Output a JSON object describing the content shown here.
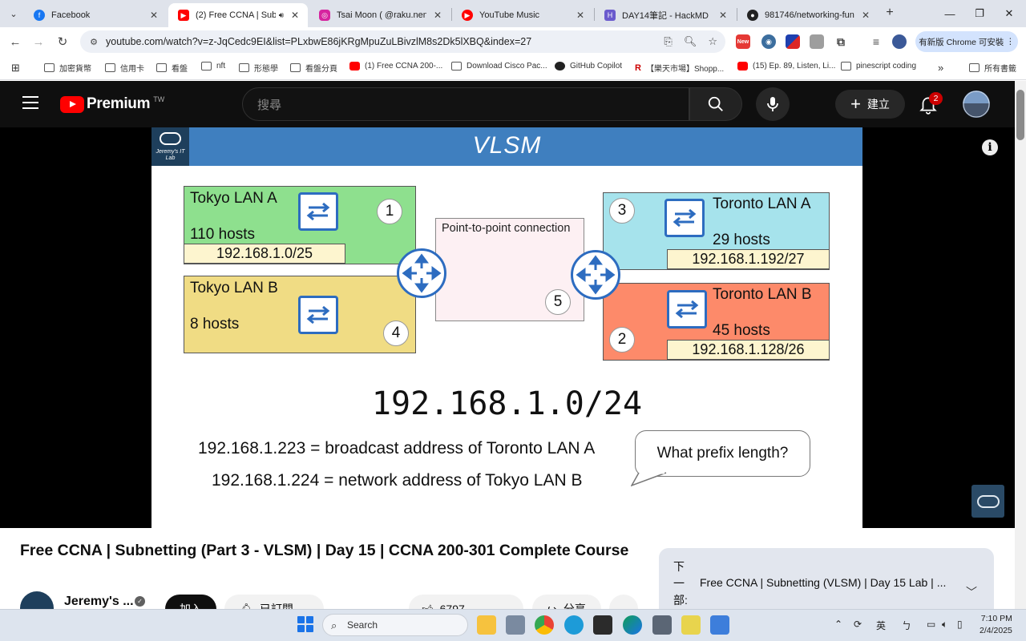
{
  "browser": {
    "tabs": [
      {
        "title": "Facebook",
        "favicon_color": "#1877f2"
      },
      {
        "title": "(2) Free CCNA | Subnet",
        "favicon_color": "#ff0000",
        "active": true
      },
      {
        "title": "Tsai Moon ( @raku.nene )",
        "favicon_color": "#d6249f"
      },
      {
        "title": "YouTube Music",
        "favicon_color": "#ff0000"
      },
      {
        "title": "DAY14筆記 - HackMD",
        "favicon_color": "#6a5acd"
      },
      {
        "title": "981746/networking-funda",
        "favicon_color": "#222222"
      }
    ],
    "url": "youtube.com/watch?v=z-JqCedc9EI&list=PLxbwE86jKRgMpuZuLBivzlM8s2Dk5lXBQ&index=27",
    "update_button": "有新版 Chrome 可安裝",
    "ext_new_badge": "New",
    "bookmarks": [
      {
        "label": "加密貨幣",
        "type": "folder"
      },
      {
        "label": "信用卡",
        "type": "folder"
      },
      {
        "label": "看盤",
        "type": "folder"
      },
      {
        "label": "nft",
        "type": "folder"
      },
      {
        "label": "形態學",
        "type": "folder"
      },
      {
        "label": "看盤分頁",
        "type": "folder"
      },
      {
        "label": "(1) Free CCNA 200-...",
        "type": "yt"
      },
      {
        "label": "Download Cisco Pac...",
        "type": "folder"
      },
      {
        "label": "GitHub Copilot",
        "type": "gh"
      },
      {
        "label": "【樂天市場】Shopp...",
        "type": "r"
      },
      {
        "label": "(15) Ep. 89, Listen, Li...",
        "type": "yt"
      },
      {
        "label": "pinescript coding",
        "type": "folder"
      }
    ],
    "bookmarks_overflow": "»",
    "all_bookmarks": "所有書籤"
  },
  "youtube": {
    "brand": "Premium",
    "region": "TW",
    "search_placeholder": "搜尋",
    "create_label": "建立",
    "notification_count": "2"
  },
  "slide": {
    "title": "VLSM",
    "logo_text": "Jeremy's IT Lab",
    "tokyo_a": {
      "name": "Tokyo LAN A",
      "hosts": "110 hosts",
      "address": "192.168.1.0/25",
      "number": "1"
    },
    "tokyo_b": {
      "name": "Tokyo LAN B",
      "hosts": "8 hosts",
      "number": "4"
    },
    "toronto_a": {
      "name": "Toronto LAN A",
      "hosts": "29 hosts",
      "address": "192.168.1.192/27",
      "number": "3"
    },
    "toronto_b": {
      "name": "Toronto LAN B",
      "hosts": "45 hosts",
      "address": "192.168.1.128/26",
      "number": "2"
    },
    "p2p": {
      "label": "Point-to-point connection",
      "number": "5"
    },
    "network": "192.168.1.0/24",
    "line1": "192.168.1.223 = broadcast address of Toronto LAN A",
    "line2": "192.168.1.224 = network address of Tokyo LAN B",
    "bubble": "What prefix length?",
    "colors": {
      "tokyo_a": "#8ee08e",
      "tokyo_b": "#f0dc84",
      "toronto_a": "#a6e3ec",
      "toronto_b": "#fd8a6a",
      "header": "#3f7fbf"
    }
  },
  "video": {
    "title": "Free CCNA | Subnetting (Part 3 - VLSM) | Day 15 | CCNA 200-301 Complete Course",
    "channel": "Jeremy's ...",
    "join_label": "加入",
    "subscribed_label": "已訂閱",
    "like_count": "6797",
    "share_label": "分享"
  },
  "playlist": {
    "next_label": "下一部:",
    "next_title": "Free CCNA | Subnetting (VLSM) | Day 15 Lab | ..."
  },
  "taskbar": {
    "search_label": "Search",
    "ime_label": "英",
    "time": "7:10 PM",
    "date": "2/4/2025"
  }
}
